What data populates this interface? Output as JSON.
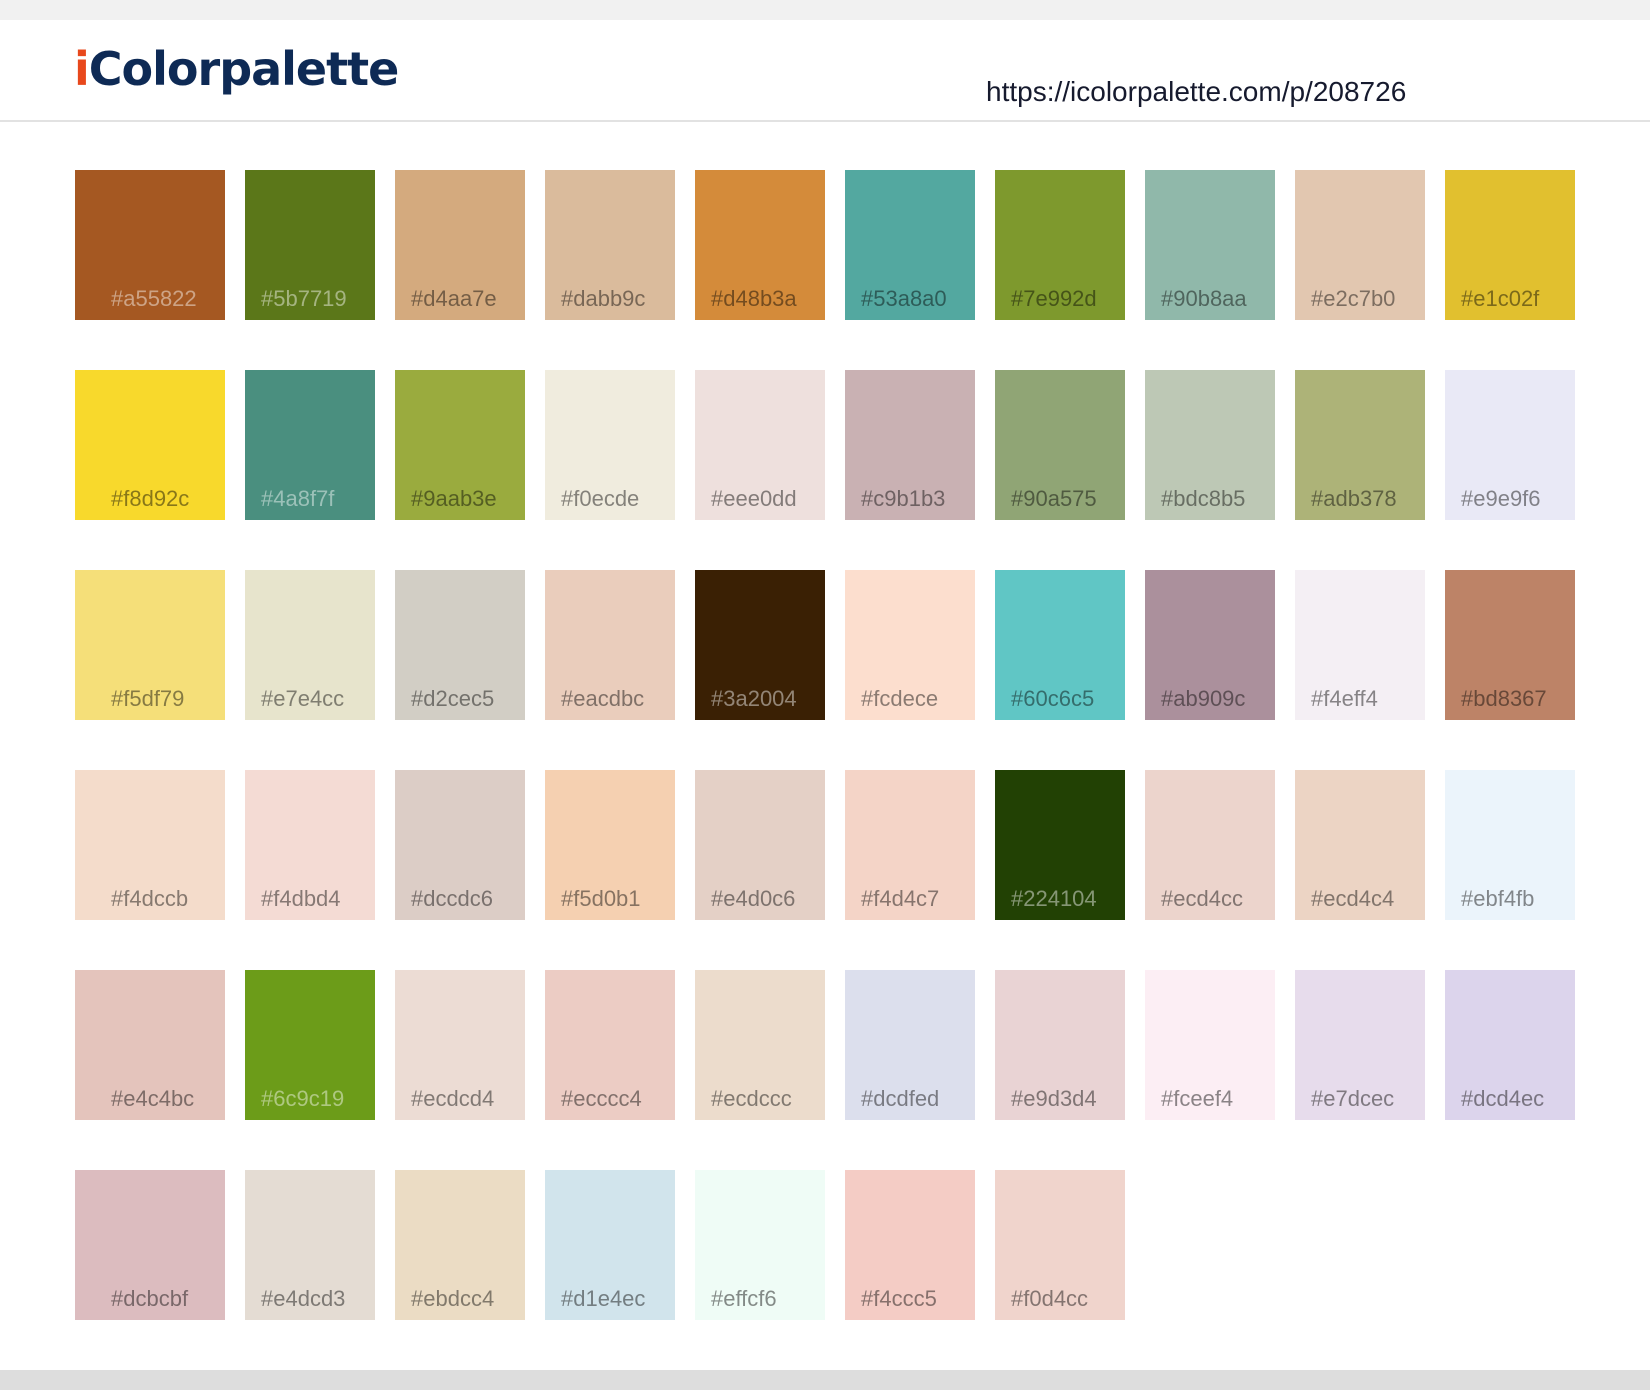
{
  "header": {
    "logo_i": "i",
    "logo_rest": "Colorpalette",
    "url": "https://icolorpalette.com/p/208726"
  },
  "swatches": [
    {
      "hex": "#a55822",
      "dark": true
    },
    {
      "hex": "#5b7719",
      "dark": true
    },
    {
      "hex": "#d4aa7e",
      "dark": false
    },
    {
      "hex": "#dabb9c",
      "dark": false
    },
    {
      "hex": "#d48b3a",
      "dark": false
    },
    {
      "hex": "#53a8a0",
      "dark": false
    },
    {
      "hex": "#7e992d",
      "dark": false
    },
    {
      "hex": "#90b8aa",
      "dark": false
    },
    {
      "hex": "#e2c7b0",
      "dark": false
    },
    {
      "hex": "#e1c02f",
      "dark": false
    },
    {
      "hex": "#f8d92c",
      "dark": false
    },
    {
      "hex": "#4a8f7f",
      "dark": true
    },
    {
      "hex": "#9aab3e",
      "dark": false
    },
    {
      "hex": "#f0ecde",
      "dark": false
    },
    {
      "hex": "#eee0dd",
      "dark": false
    },
    {
      "hex": "#c9b1b3",
      "dark": false
    },
    {
      "hex": "#90a575",
      "dark": false
    },
    {
      "hex": "#bdc8b5",
      "dark": false
    },
    {
      "hex": "#adb378",
      "dark": false
    },
    {
      "hex": "#e9e9f6",
      "dark": false
    },
    {
      "hex": "#f5df79",
      "dark": false
    },
    {
      "hex": "#e7e4cc",
      "dark": false
    },
    {
      "hex": "#d2cec5",
      "dark": false
    },
    {
      "hex": "#eacdbc",
      "dark": false
    },
    {
      "hex": "#3a2004",
      "dark": true
    },
    {
      "hex": "#fcdece",
      "dark": false
    },
    {
      "hex": "#60c6c5",
      "dark": false
    },
    {
      "hex": "#ab909c",
      "dark": false
    },
    {
      "hex": "#f4eff4",
      "dark": false
    },
    {
      "hex": "#bd8367",
      "dark": false
    },
    {
      "hex": "#f4dccb",
      "dark": false
    },
    {
      "hex": "#f4dbd4",
      "dark": false
    },
    {
      "hex": "#dccdc6",
      "dark": false
    },
    {
      "hex": "#f5d0b1",
      "dark": false
    },
    {
      "hex": "#e4d0c6",
      "dark": false
    },
    {
      "hex": "#f4d4c7",
      "dark": false
    },
    {
      "hex": "#224104",
      "dark": true
    },
    {
      "hex": "#ecd4cc",
      "dark": false
    },
    {
      "hex": "#ecd4c4",
      "dark": false
    },
    {
      "hex": "#ebf4fb",
      "dark": false
    },
    {
      "hex": "#e4c4bc",
      "dark": false
    },
    {
      "hex": "#6c9c19",
      "dark": true
    },
    {
      "hex": "#ecdcd4",
      "dark": false
    },
    {
      "hex": "#ecccc4",
      "dark": false
    },
    {
      "hex": "#ecdccc",
      "dark": false
    },
    {
      "hex": "#dcdfed",
      "dark": false
    },
    {
      "hex": "#e9d3d4",
      "dark": false
    },
    {
      "hex": "#fceef4",
      "dark": false
    },
    {
      "hex": "#e7dcec",
      "dark": false
    },
    {
      "hex": "#dcd4ec",
      "dark": false
    },
    {
      "hex": "#dcbcbf",
      "dark": false
    },
    {
      "hex": "#e4dcd3",
      "dark": false
    },
    {
      "hex": "#ebdcc4",
      "dark": false
    },
    {
      "hex": "#d1e4ec",
      "dark": false
    },
    {
      "hex": "#effcf6",
      "dark": false
    },
    {
      "hex": "#f4ccc5",
      "dark": false
    },
    {
      "hex": "#f0d4cc",
      "dark": false
    }
  ]
}
